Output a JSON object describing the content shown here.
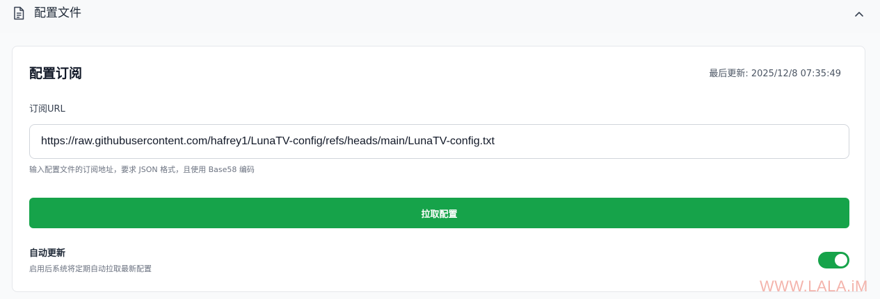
{
  "section": {
    "title": "配置文件",
    "icon": "document-icon",
    "collapse_icon": "chevron-up-icon"
  },
  "card": {
    "title": "配置订阅",
    "last_updated": "最后更新: 2025/12/8 07:35:49",
    "url_label": "订阅URL",
    "url_value": "https://raw.githubusercontent.com/hafrey1/LunaTV-config/refs/heads/main/LunaTV-config.txt",
    "url_hint": "输入配置文件的订阅地址，要求 JSON 格式，且使用 Base58 编码",
    "fetch_button": "拉取配置",
    "auto_update": {
      "label": "自动更新",
      "description": "启用后系统将定期自动拉取最新配置",
      "enabled": true
    }
  },
  "watermark": "WWW.LALA.iM",
  "colors": {
    "accent": "#16a34a",
    "watermark": "#f4b4ac"
  }
}
